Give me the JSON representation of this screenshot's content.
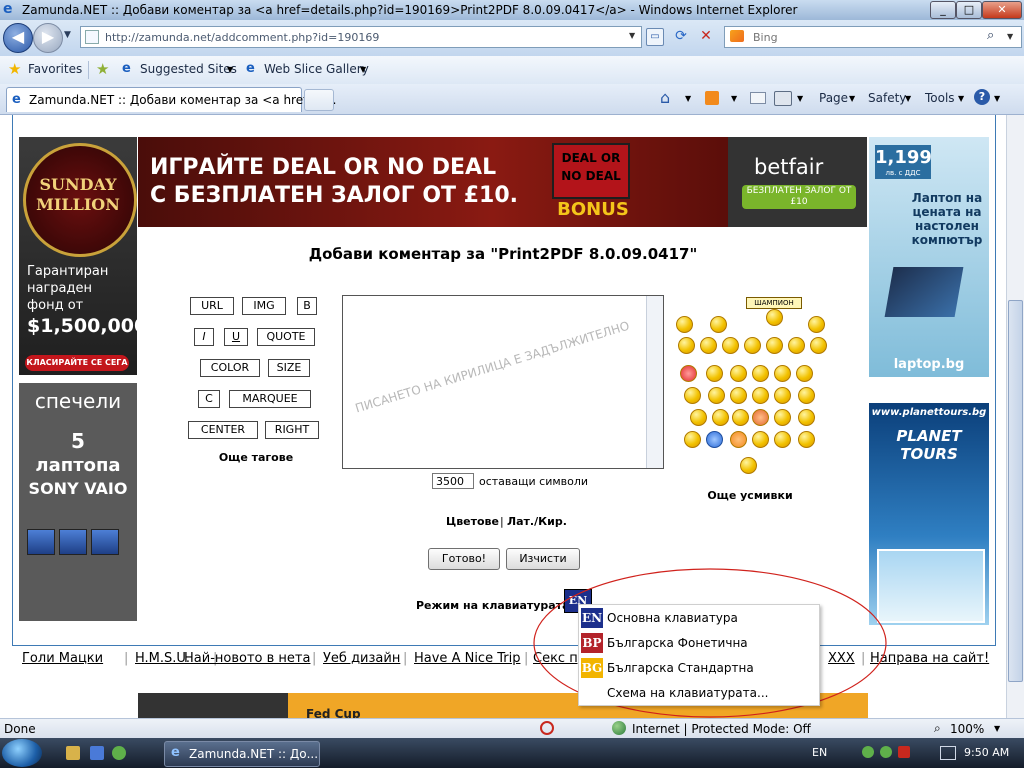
{
  "window": {
    "title": "Zamunda.NET :: Добави коментар за <a href=details.php?id=190169>Print2PDF 8.0.09.0417</a> - Windows Internet Explorer"
  },
  "addressbar": {
    "url": "http://zamunda.net/addcomment.php?id=190169",
    "search_placeholder": "Bing"
  },
  "favbar": {
    "favorites": "Favorites",
    "suggested": "Suggested Sites",
    "webslice": "Web Slice Gallery"
  },
  "tabbar": {
    "tab_title": "Zamunda.NET :: Добави коментар за <a href=d...",
    "page": "Page",
    "safety": "Safety",
    "tools": "Tools"
  },
  "ads": {
    "sunday_title": "SUNDAY MILLION",
    "sunday_text": "Гарантиран награден фонд от",
    "sunday_amount": "$1,500,000",
    "sunday_cta": "КЛАСИРАЙТЕ СЕ СЕГА",
    "banner_line1": "ИГРАЙТЕ  DEAL OR NO DEAL",
    "banner_line2": "С БЕЗПЛАТЕН ЗАЛОГ ОТ £10.",
    "banner_bonus": "BONUS",
    "banner_deal": "DEAL OR NO DEAL",
    "betfair": "betfair",
    "betfair_sub": "БЕЗПЛАТЕН ЗАЛОГ ОТ £10",
    "laptop_price": "1,199",
    "laptop_price_sub": "лв. с ДДС",
    "laptop_text": "Лаптоп на цената на настолен компютър",
    "laptop_site": "laptop.bg",
    "sony_l1": "спечели",
    "sony_l2": "5",
    "sony_l3": "лаптопа",
    "sony_l4": "SONY VAIO",
    "planet_site": "www.planettours.bg",
    "planet_name": "PLANET TOURS"
  },
  "form": {
    "heading": "Добави коментар за \"Print2PDF 8.0.09.0417\"",
    "tags": {
      "url": "URL",
      "img": "IMG",
      "b": "B",
      "i": "I",
      "u": "U",
      "quote": "QUOTE",
      "color": "COLOR",
      "size": "SIZE",
      "c": "C",
      "marquee": "MARQUEE",
      "center": "CENTER",
      "right": "RIGHT"
    },
    "more_tags": "Още тагове",
    "watermark": "ПИСАНЕТО НА КИРИЛИЦА Е ЗАДЪЛЖИТЕЛНО",
    "char_count": "3500",
    "chars_left": "оставащи символи",
    "colors_link": "Цветове",
    "separator": "|",
    "latkir_link": "Лат./Кир.",
    "submit": "Готово!",
    "clear": "Изчисти",
    "kb_mode_label": "Режим на клавиатурата:",
    "kb_current": "EN",
    "smile_badge": "ШАМПИОН",
    "more_smilies": "Още усмивки"
  },
  "kbmenu": {
    "items": [
      {
        "code": "EN",
        "label": "Основна клавиатура",
        "color": "#1c2f8c"
      },
      {
        "code": "BP",
        "label": "Българска Фонетична",
        "color": "#b3232a"
      },
      {
        "code": "BG",
        "label": "Българска Стандартна",
        "color": "#f2b400"
      },
      {
        "code": "",
        "label": "Схема на клавиатурата..."
      }
    ]
  },
  "footer": {
    "links": [
      "Голи Мацки",
      "H.M.S.U.",
      "Най-новото в нета",
      "Уеб дизайн",
      "Have A Nice Trip",
      "Секс пр",
      "XXX",
      "Направа на сайт!"
    ],
    "sep": "|",
    "bottom_ad": "Fed Cup"
  },
  "status": {
    "done": "Done",
    "zone": "Internet | Protected Mode: Off",
    "zoom": "100%"
  },
  "taskbar": {
    "task": "Zamunda.NET :: До...",
    "lang": "EN",
    "time": "9:50 AM"
  }
}
